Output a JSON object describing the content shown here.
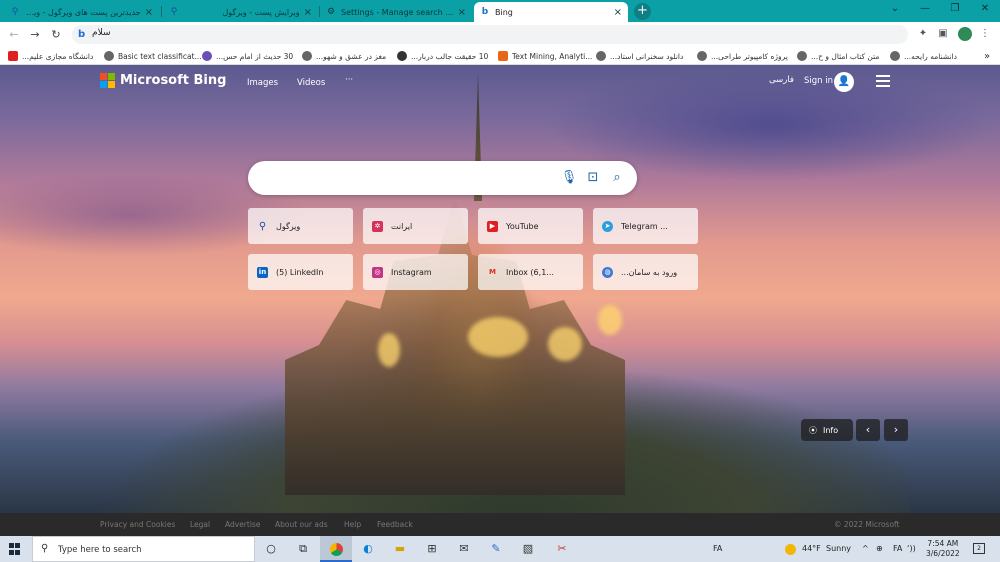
{
  "browser": {
    "tabs": [
      {
        "title": "جدیدترین پست های ویرگول - ویرگ",
        "active": false
      },
      {
        "title": "ویرایش پست - ویرگول",
        "active": false
      },
      {
        "title": "Settings - Manage search engine",
        "active": false
      },
      {
        "title": "Bing",
        "active": true
      }
    ],
    "new_tab": "+",
    "window": {
      "minimize": "⌄",
      "restore": "—",
      "maximize": "❐",
      "close": "✕"
    },
    "omnibox": {
      "value": "سلام"
    },
    "bookmarks": [
      {
        "label": "دانشگاه مجازی علیم...",
        "color": "#e02020"
      },
      {
        "label": "Basic text classificat...",
        "color": "#444"
      },
      {
        "label": "30 حدیث از امام حس...",
        "color": "#6a4fb5"
      },
      {
        "label": "مغز در عشق و شهو...",
        "color": "#444"
      },
      {
        "label": "10 حقیقت جالب دربار...",
        "color": "#333"
      },
      {
        "label": "Text Mining, Analyti...",
        "color": "#e8651a"
      },
      {
        "label": "دانلود سخنرانی استاد...",
        "color": "#444"
      },
      {
        "label": "پروژه کامپیوتر طراحی...",
        "color": "#444"
      },
      {
        "label": "متن کتاب امثال و ح...",
        "color": "#444"
      },
      {
        "label": "دانشنامه رایحه...",
        "color": "#444"
      }
    ],
    "bookmarks_more": "»"
  },
  "bing": {
    "brand": "Microsoft Bing",
    "logo_colors": [
      "#f25022",
      "#7fba00",
      "#00a4ef",
      "#ffb900"
    ],
    "nav": {
      "images": "Images",
      "videos": "Videos",
      "more": "···"
    },
    "language": "فارسی",
    "sign_in": "Sign in",
    "search": {
      "value": ""
    },
    "tiles": [
      {
        "label": "ویرگول",
        "icon": "virgool-icon",
        "glyph": "⚲",
        "color": "#1a4fa0"
      },
      {
        "label": "ایرانت",
        "icon": "irannet-icon",
        "glyph": "✲",
        "color": "#d6335c"
      },
      {
        "label": "YouTube",
        "icon": "youtube-icon",
        "glyph": "▶",
        "color": "#e02020"
      },
      {
        "label": "Telegram ...",
        "icon": "telegram-icon",
        "glyph": "➤",
        "color": "#2a9fd9"
      },
      {
        "label": "(5) LinkedIn",
        "icon": "linkedin-icon",
        "glyph": "in",
        "color": "#0a66c2"
      },
      {
        "label": "Instagram",
        "icon": "instagram-icon",
        "glyph": "◎",
        "color": "#c13584"
      },
      {
        "label": "Inbox (6,1...",
        "icon": "gmail-icon",
        "glyph": "M",
        "color": "#d93025"
      },
      {
        "label": "ورود به سامان...",
        "icon": "globe-icon",
        "glyph": "◍",
        "color": "#3d7ad6"
      }
    ],
    "info": "Info",
    "prev": "‹",
    "next": "›",
    "footer": {
      "links": [
        "Privacy and Cookies",
        "Legal",
        "Advertise",
        "About our ads",
        "Help",
        "Feedback"
      ],
      "copyright": "© 2022 Microsoft"
    }
  },
  "taskbar": {
    "search_placeholder": "Type here to search",
    "language": "FA",
    "weather": {
      "temp": "44°F",
      "condition": "Sunny"
    },
    "time": "7:54 AM",
    "date": "3/6/2022",
    "notification_count": "2",
    "tray_icons": [
      "^",
      "⊕",
      "FA",
      "ʻ))"
    ]
  }
}
